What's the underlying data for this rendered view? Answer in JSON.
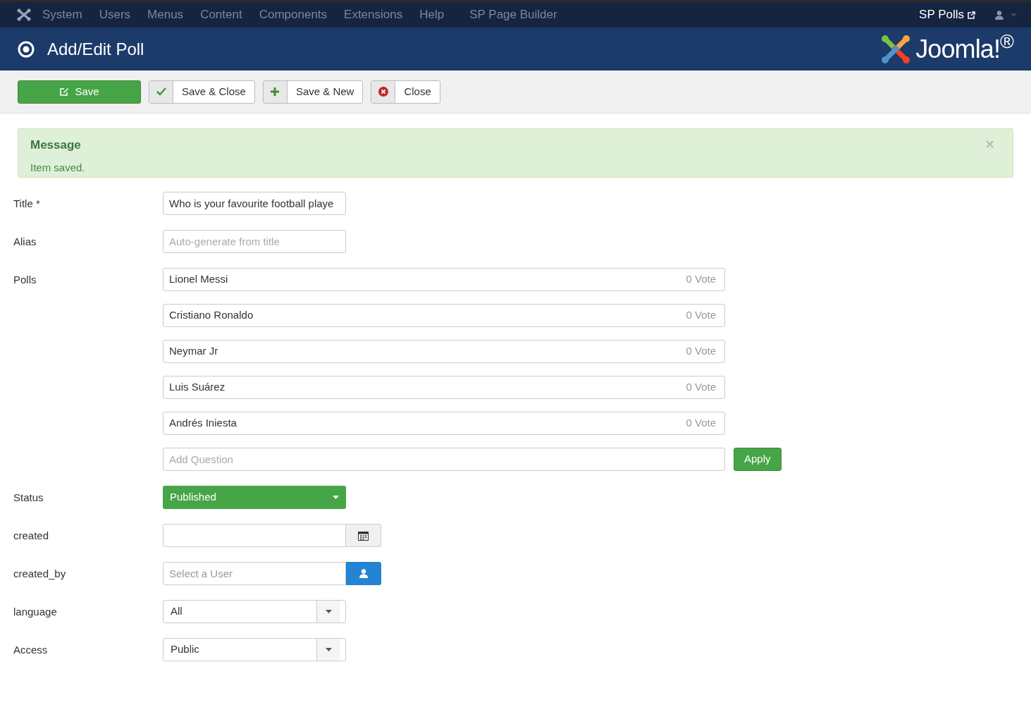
{
  "nav": {
    "items": [
      "System",
      "Users",
      "Menus",
      "Content",
      "Components",
      "Extensions",
      "Help",
      "SP Page Builder"
    ],
    "site_link": "SP Polls"
  },
  "header": {
    "title": "Add/Edit Poll",
    "logo_text": "Joomla!$^{®}$"
  },
  "toolbar": [
    {
      "label": "Save",
      "kind": "save"
    },
    {
      "label": "Save & Close",
      "kind": "saveclose"
    },
    {
      "label": "Save & New",
      "kind": "savenew"
    },
    {
      "label": "Close",
      "kind": "close"
    }
  ],
  "message": {
    "heading": "Message",
    "text": "Item saved."
  },
  "fields": [
    {
      "label": "Title *",
      "kind": "text",
      "value": "Who is your favourite football playe"
    },
    {
      "label": "Alias",
      "kind": "text",
      "placeholder": "Auto-generate from title"
    },
    {
      "label": "Polls",
      "kind": "polls",
      "options": [
        {
          "name": "Lionel Messi",
          "votes": "0 Vote"
        },
        {
          "name": "Cristiano Ronaldo",
          "votes": "0 Vote"
        },
        {
          "name": "Neymar Jr",
          "votes": "0 Vote"
        },
        {
          "name": "Luis Suárez",
          "votes": "0 Vote"
        },
        {
          "name": "Andrés Iniesta",
          "votes": "0 Vote"
        }
      ],
      "placeholder": "Add Question",
      "button": "Apply"
    },
    {
      "label": "Status",
      "kind": "status",
      "value": "Published"
    },
    {
      "label": "created",
      "kind": "date"
    },
    {
      "label": "created_by",
      "kind": "user",
      "placeholder": "Select a User"
    },
    {
      "label": "language",
      "kind": "select",
      "value": "All"
    },
    {
      "label": "Access",
      "kind": "select",
      "value": "Public"
    }
  ]
}
